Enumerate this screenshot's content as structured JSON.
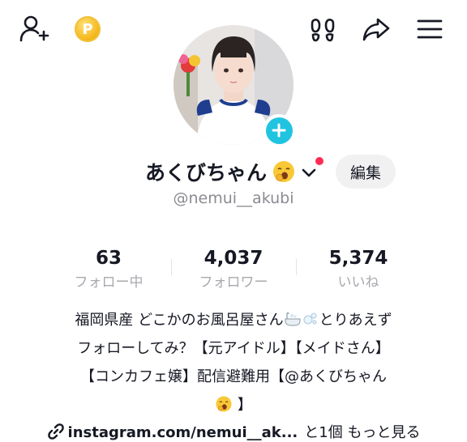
{
  "header": {
    "coin_symbol": "P",
    "icons": [
      "add-user-icon",
      "coin-icon",
      "footprints-icon",
      "share-icon",
      "menu-icon"
    ]
  },
  "profile": {
    "display_name": "あくびちゃん",
    "username": "@nemui__akubi",
    "edit_label": "編集",
    "has_notification_dot": true
  },
  "stats": [
    {
      "value": "63",
      "label": "フォロー中"
    },
    {
      "value": "4,037",
      "label": "フォロワー"
    },
    {
      "value": "5,374",
      "label": "いいね"
    }
  ],
  "bio": {
    "line1": "福岡県産 どこかのお風呂屋さん",
    "line1_end": "とりあえず",
    "line2": "フォローしてみ？【元アイドル】【メイドさん】",
    "line3": "【コンカフェ嬢】配信避難用【@あくびちゃん",
    "line4": "】"
  },
  "link": {
    "url_text": "instagram.com/nemui__ak...",
    "more_count_text": "と1個 もっと見る"
  },
  "colors": {
    "accent_plus": "#20c4e0",
    "notification": "#fe2c55",
    "secondary_text": "#8a8b91"
  }
}
